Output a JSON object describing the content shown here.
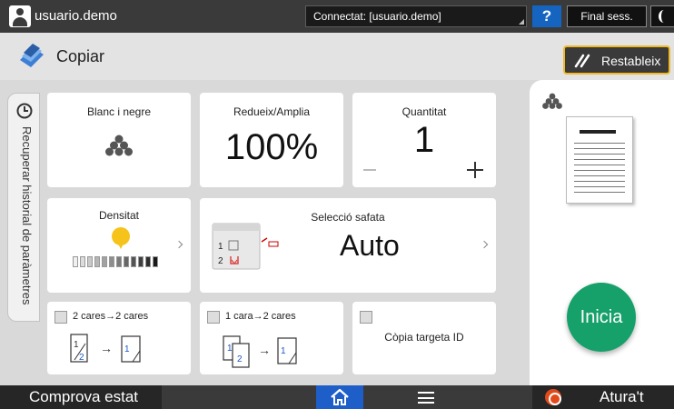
{
  "topbar": {
    "username": "usuario.demo",
    "connection": "Connectat: [usuario.demo]",
    "help_label": "?",
    "logout_label": "Final sess."
  },
  "header": {
    "title": "Copiar",
    "reset_label": "Restableix"
  },
  "history": {
    "label": "Recuperar historial de paràmetres"
  },
  "tiles": {
    "color": {
      "title": "Blanc i negre"
    },
    "zoom": {
      "title": "Redueix/Amplia",
      "value": "100%"
    },
    "quantity": {
      "title": "Quantitat",
      "value": "1"
    },
    "density": {
      "title": "Densitat",
      "level": 0.55,
      "steps": 12
    },
    "tray": {
      "title": "Selecció safata",
      "value": "Auto"
    },
    "duplex1": {
      "label": "2 cares→2 cares"
    },
    "duplex2": {
      "label": "1 cara→2 cares"
    },
    "idcard": {
      "label": "Còpia targeta ID"
    }
  },
  "preview": {
    "start_label": "Inicia"
  },
  "bottombar": {
    "status_label": "Comprova estat",
    "stop_label": "Atura't"
  },
  "colors": {
    "topbar": "#3a3a3a",
    "accent_yellow": "#f0b928",
    "start_green": "#16a06a",
    "home_blue": "#1e5ec9",
    "stop_orange": "#e24a1a"
  }
}
